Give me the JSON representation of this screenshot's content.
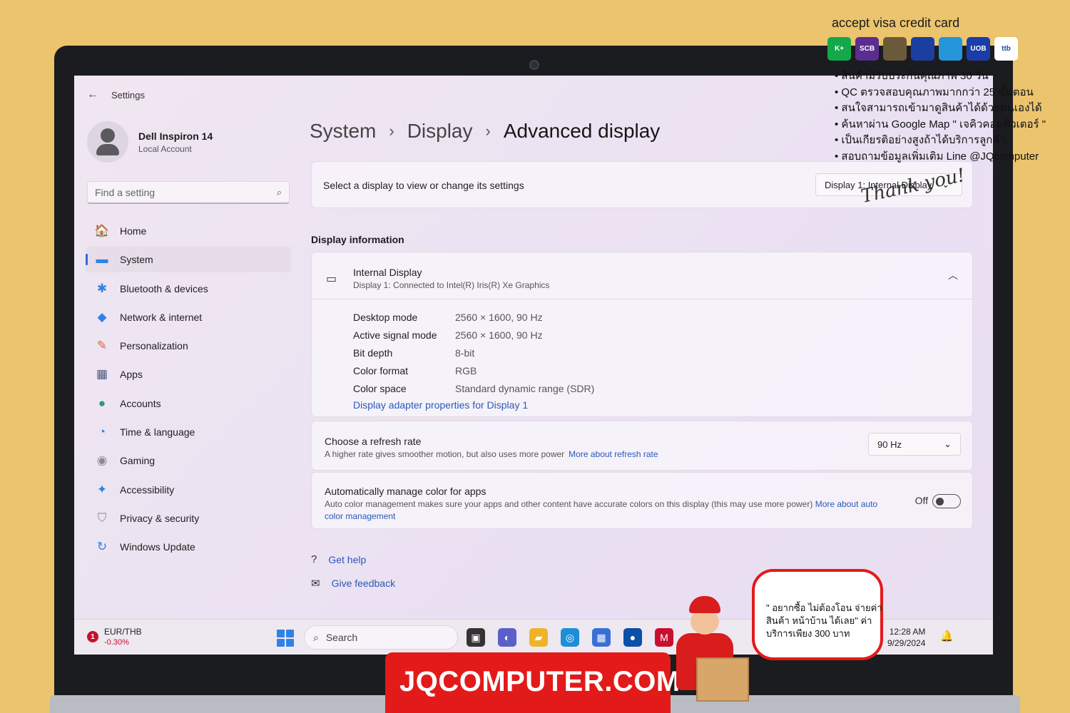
{
  "overlay": {
    "visa_text": "accept visa credit card",
    "banks": [
      {
        "label": "K+",
        "color": "#13a84a"
      },
      {
        "label": "SCB",
        "color": "#5b2d8e"
      },
      {
        "label": "",
        "color": "#6b5a3a"
      },
      {
        "label": "",
        "color": "#1b3f9e"
      },
      {
        "label": "",
        "color": "#2596d9"
      },
      {
        "label": "UOB",
        "color": "#1a3da8"
      },
      {
        "label": "ttb",
        "color": "#ffffff"
      }
    ],
    "promo": [
      "สินค้ามีรับประกันคุณภาพ 30 วัน",
      "QC ตรวจสอบคุณภาพมากกว่า 25 ขั้นตอน",
      "สนใจสามารถเข้ามาดูสินค้าได้ด้วยตนเองได้",
      "ค้นหาผ่าน Google Map \" เจคิวคอมพิวเตอร์ \"",
      "เป็นเกียรติอย่างสูงถ้าได้บริการลูกค้า",
      "สอบถามข้อมูลเพิ่มเติม Line @JQcomputer"
    ],
    "thank_you": "Thank you!",
    "brand": "JQCOMPUTER.COM",
    "bubble_text": "\" อยากซื้อ ไม่ต้องโอน จ่ายค่าสินค้า หน้าบ้าน ได้เลย\" ค่าบริการเพียง 300 บาท"
  },
  "window": {
    "title": "Settings",
    "profile_name": "Dell Inspiron 14",
    "profile_sub": "Local Account",
    "search_placeholder": "Find a setting"
  },
  "nav": [
    {
      "label": "Home",
      "icon": "🏠",
      "color": "#d9643a"
    },
    {
      "label": "System",
      "icon": "▬",
      "color": "#2f83e6"
    },
    {
      "label": "Bluetooth & devices",
      "icon": "✱",
      "color": "#2f83e6"
    },
    {
      "label": "Network & internet",
      "icon": "◆",
      "color": "#2f83e6"
    },
    {
      "label": "Personalization",
      "icon": "✎",
      "color": "#d9643a"
    },
    {
      "label": "Apps",
      "icon": "▦",
      "color": "#4a5a7a"
    },
    {
      "label": "Accounts",
      "icon": "●",
      "color": "#2a9d6b"
    },
    {
      "label": "Time & language",
      "icon": "◔",
      "color": "#2f83e6"
    },
    {
      "label": "Gaming",
      "icon": "◉",
      "color": "#8a8a95"
    },
    {
      "label": "Accessibility",
      "icon": "✦",
      "color": "#2f83e6"
    },
    {
      "label": "Privacy & security",
      "icon": "⛉",
      "color": "#8a8a95"
    },
    {
      "label": "Windows Update",
      "icon": "↻",
      "color": "#2f83e6"
    }
  ],
  "breadcrumb": [
    "System",
    "Display",
    "Advanced display"
  ],
  "select_display": {
    "label": "Select a display to view or change its settings",
    "value": "Display 1: Internal Display"
  },
  "display_info": {
    "section_title": "Display information",
    "name": "Internal Display",
    "subtitle": "Display 1: Connected to Intel(R) Iris(R) Xe Graphics",
    "rows": [
      {
        "k": "Desktop mode",
        "v": "2560 × 1600, 90 Hz"
      },
      {
        "k": "Active signal mode",
        "v": "2560 × 1600, 90 Hz"
      },
      {
        "k": "Bit depth",
        "v": "8-bit"
      },
      {
        "k": "Color format",
        "v": "RGB"
      },
      {
        "k": "Color space",
        "v": "Standard dynamic range (SDR)"
      }
    ],
    "adapter_link": "Display adapter properties for Display 1"
  },
  "refresh": {
    "title": "Choose a refresh rate",
    "desc": "A higher rate gives smoother motion, but also uses more power",
    "link": "More about refresh rate",
    "value": "90 Hz"
  },
  "auto_color": {
    "title": "Automatically manage color for apps",
    "desc": "Auto color management makes sure your apps and other content have accurate colors on this display (this may use more power)",
    "link": "More about auto color management",
    "toggle_label": "Off"
  },
  "help": {
    "get_help": "Get help",
    "feedback": "Give feedback"
  },
  "taskbar": {
    "widget_badge": "1",
    "widget_title": "EUR/THB",
    "widget_value": "-0.30%",
    "search": "Search",
    "time": "12:28 AM",
    "date": "9/29/2024"
  }
}
